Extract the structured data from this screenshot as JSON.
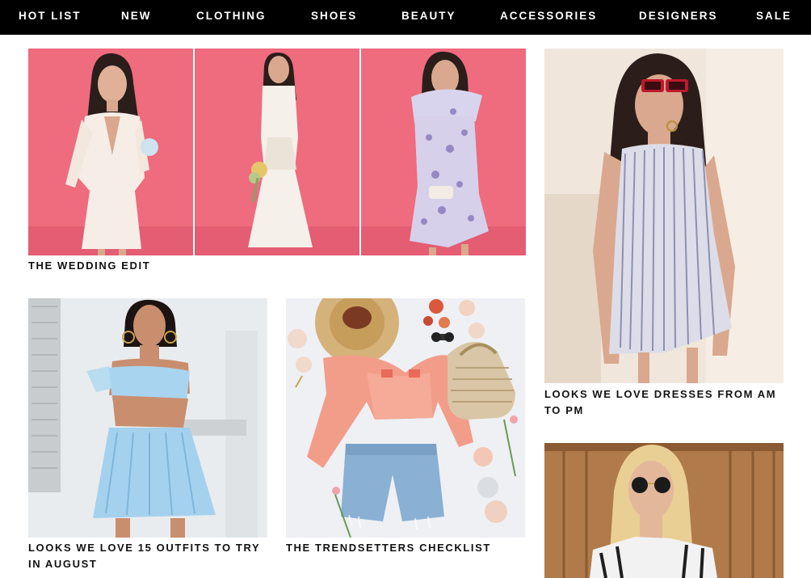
{
  "nav": {
    "items": [
      {
        "label": "HOT LIST"
      },
      {
        "label": "NEW"
      },
      {
        "label": "CLOTHING"
      },
      {
        "label": "SHOES"
      },
      {
        "label": "BEAUTY"
      },
      {
        "label": "ACCESSORIES"
      },
      {
        "label": "DESIGNERS"
      },
      {
        "label": "SALE"
      }
    ]
  },
  "features": {
    "wedding": {
      "caption": "THE WEDDING EDIT"
    },
    "dresses": {
      "caption": "LOOKS WE LOVE DRESSES FROM AM TO PM"
    },
    "august": {
      "caption": "LOOKS WE LOVE 15 OUTFITS TO TRY IN AUGUST"
    },
    "trendsetters": {
      "caption": "THE TRENDSETTERS CHECKLIST"
    }
  },
  "colors": {
    "nav_bg": "#000000",
    "nav_text": "#ffffff",
    "wedding_bg": "#ef6b7e",
    "caption_text": "#111111"
  }
}
